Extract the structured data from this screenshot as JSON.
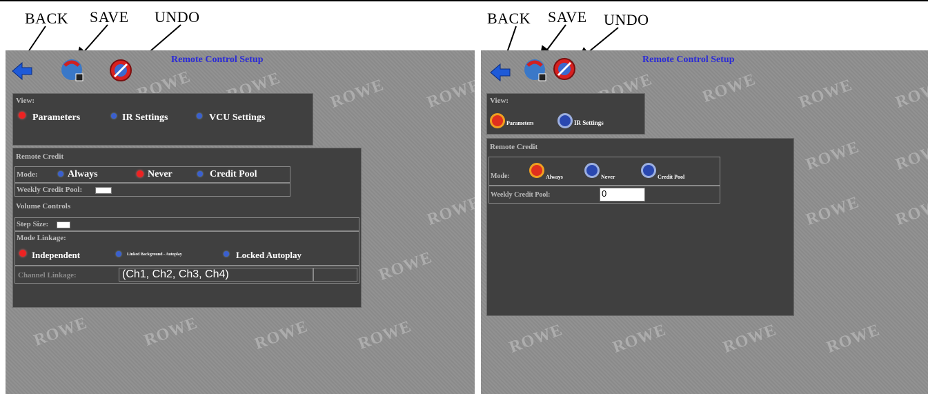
{
  "callouts": {
    "left": {
      "back": "BACK",
      "save": "SAVE",
      "undo": "UNDO"
    },
    "right": {
      "back": "BACK",
      "save": "SAVE",
      "undo": "UNDO"
    }
  },
  "watermark": "ROWE",
  "left_screen": {
    "title": "Remote Control Setup",
    "view": {
      "label": "View:",
      "options": [
        "Parameters",
        "IR Settings",
        "VCU Settings"
      ],
      "selected": "Parameters"
    },
    "remote_credit": {
      "header": "Remote Credit",
      "mode_label": "Mode:",
      "mode_options": [
        "Always",
        "Never",
        "Credit Pool"
      ],
      "mode_selected": "Never",
      "weekly_pool_label": "Weekly Credit Pool:",
      "weekly_pool_value": ""
    },
    "volume_controls": {
      "header": "Volume Controls",
      "step_size_label": "Step Size:",
      "step_size_value": "",
      "mode_linkage_label": "Mode Linkage:",
      "linkage_options": [
        "Independent",
        "Linked Background - Autoplay",
        "Locked Autoplay"
      ],
      "linkage_selected": "Independent",
      "channel_linkage_label": "Channel Linkage:",
      "channel_linkage_value": "(Ch1, Ch2, Ch3, Ch4)"
    }
  },
  "right_screen": {
    "title": "Remote Control Setup",
    "view": {
      "label": "View:",
      "options": [
        "Parameters",
        "IR Settings"
      ],
      "selected": "Parameters"
    },
    "remote_credit": {
      "header": "Remote Credit",
      "mode_label": "Mode:",
      "mode_options": [
        "Always",
        "Never",
        "Credit Pool"
      ],
      "mode_selected": "Always",
      "weekly_pool_label": "Weekly Credit Pool:",
      "weekly_pool_value": "0"
    }
  },
  "colors": {
    "screen_bg": "#8e8e8e",
    "panel_bg": "#404040",
    "title_blue": "#2b2bd6",
    "selected_red": "#e22222",
    "unselected_blue": "#3a5fcf"
  },
  "icons": {
    "back": "back-arrow-icon",
    "save": "save-icon",
    "undo": "undo-icon"
  }
}
